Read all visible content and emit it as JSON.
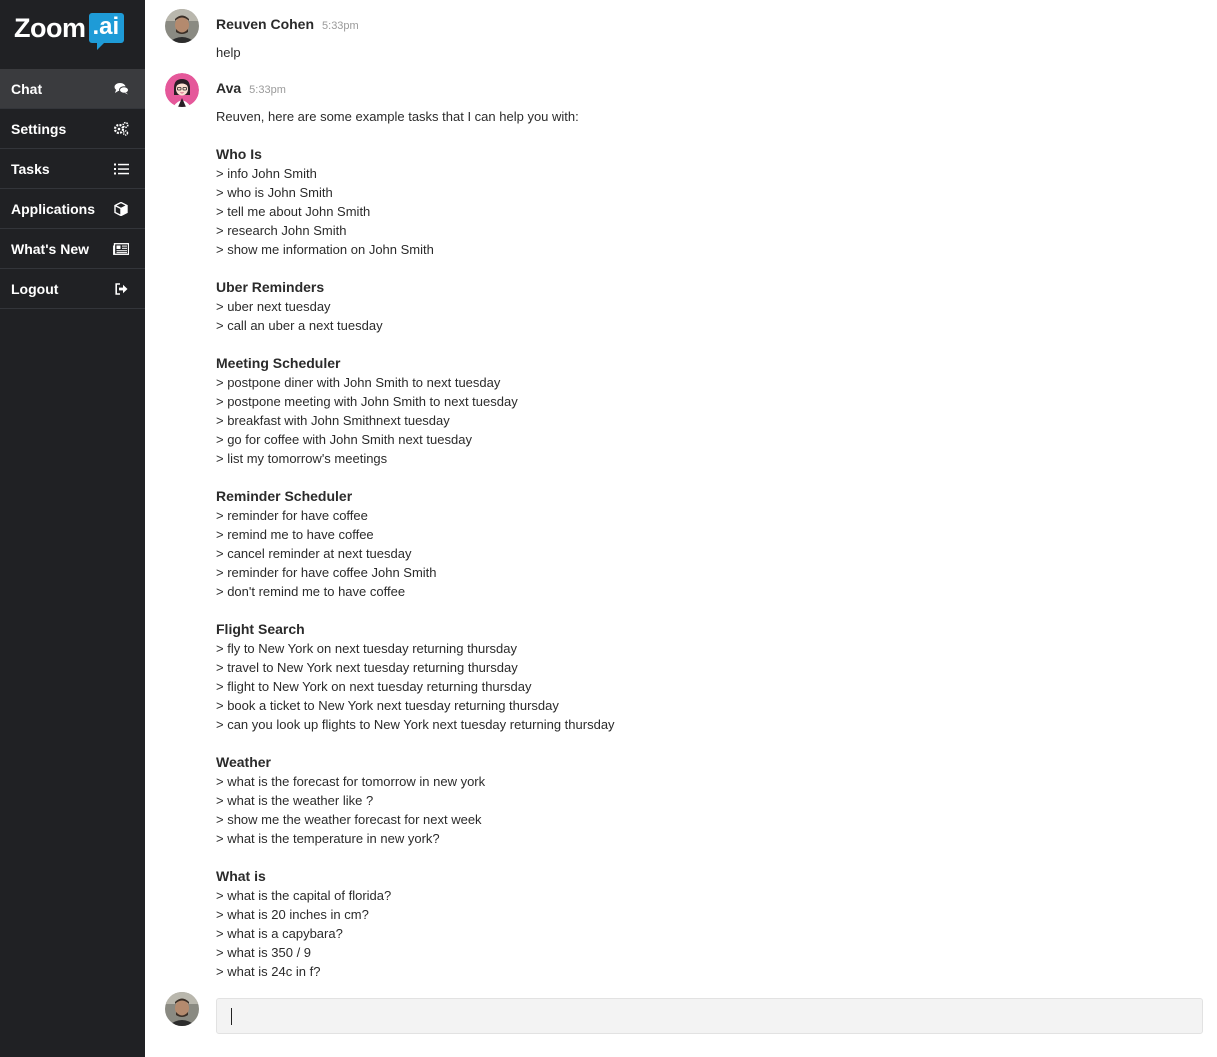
{
  "brand": {
    "logo_text": "Zoom",
    "logo_badge": ".ai",
    "badge_color": "#1e9bd7"
  },
  "sidebar": {
    "items": [
      {
        "label": "Chat",
        "icon": "chat-bubbles-icon",
        "active": true
      },
      {
        "label": "Settings",
        "icon": "gears-icon",
        "active": false
      },
      {
        "label": "Tasks",
        "icon": "list-icon",
        "active": false
      },
      {
        "label": "Applications",
        "icon": "cube-icon",
        "active": false
      },
      {
        "label": "What's New",
        "icon": "newspaper-icon",
        "active": false
      },
      {
        "label": "Logout",
        "icon": "sign-out-icon",
        "active": false
      }
    ]
  },
  "messages": {
    "user_msg": {
      "sender": "Reuven Cohen",
      "time": "5:33pm",
      "text": "help"
    },
    "bot_msg": {
      "sender": "Ava",
      "time": "5:33pm",
      "intro": "Reuven, here are some example tasks that I can help you with:",
      "sections": [
        {
          "title": "Who Is",
          "lines": [
            "> info John Smith",
            "> who is John Smith",
            "> tell me about John Smith",
            "> research John Smith",
            "> show me information on John Smith"
          ]
        },
        {
          "title": "Uber Reminders",
          "lines": [
            "> uber next tuesday",
            "> call an uber a next tuesday"
          ]
        },
        {
          "title": "Meeting Scheduler",
          "lines": [
            "> postpone diner with John Smith to next tuesday",
            "> postpone meeting with John Smith to next tuesday",
            "> breakfast with John Smithnext tuesday",
            "> go for coffee with John Smith next tuesday",
            "> list my tomorrow's meetings"
          ]
        },
        {
          "title": "Reminder Scheduler",
          "lines": [
            "> reminder for have coffee",
            "> remind me to have coffee",
            "> cancel reminder at next tuesday",
            "> reminder for have coffee John Smith",
            "> don't remind me to have coffee"
          ]
        },
        {
          "title": "Flight Search",
          "lines": [
            "> fly to New York on next tuesday returning thursday",
            "> travel to New York next tuesday returning thursday",
            "> flight to New York on next tuesday returning thursday",
            "> book a ticket to New York next tuesday returning thursday",
            "> can you look up flights to New York next tuesday returning thursday"
          ]
        },
        {
          "title": "Weather",
          "lines": [
            "> what is the forecast for tomorrow in new york",
            "> what is the weather like ?",
            "> show me the weather forecast for next week",
            "> what is the temperature in new york?"
          ]
        },
        {
          "title": "What is",
          "lines": [
            "> what is the capital of florida?",
            "> what is 20 inches in cm?",
            "> what is a capybara?",
            "> what is 350 / 9",
            "> what is 24c in f?"
          ]
        }
      ]
    }
  },
  "composer": {
    "value": "",
    "placeholder": ""
  }
}
